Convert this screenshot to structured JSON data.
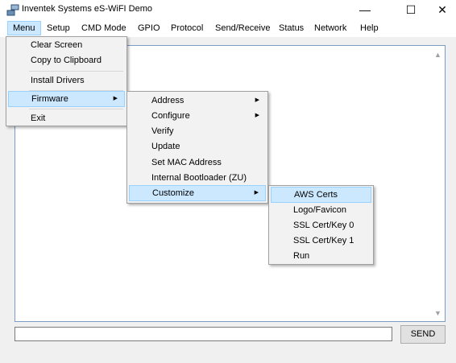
{
  "window": {
    "title": "Inventek Systems eS-WiFI Demo",
    "minimize_icon": "minimize-icon",
    "maximize_icon": "maximize-icon",
    "close_icon": "close-icon",
    "minimize_glyph": "—",
    "maximize_glyph": "☐",
    "close_glyph": "✕"
  },
  "menubar": {
    "items": [
      "Menu",
      "Setup",
      "CMD Mode",
      "GPIO",
      "Protocol",
      "Send/Receive",
      "Status",
      "Network",
      "Help"
    ],
    "active": "Menu"
  },
  "menu_dropdown": {
    "items": [
      "Clear Screen",
      "Copy to Clipboard",
      "Install Drivers",
      "Firmware",
      "Exit"
    ],
    "highlighted": "Firmware"
  },
  "firmware_submenu": {
    "items": [
      "Address",
      "Configure",
      "Verify",
      "Update",
      "Set MAC Address",
      "Internal Bootloader (ZU)",
      "Customize"
    ],
    "highlighted": "Customize"
  },
  "customize_submenu": {
    "items": [
      "AWS Certs",
      "Logo/Favicon",
      "SSL Cert/Key 0",
      "SSL Cert/Key 1",
      "Run"
    ],
    "highlighted": "AWS Certs"
  },
  "command": {
    "value": "",
    "send_label": "SEND"
  },
  "icons": {
    "submenu_arrow": "▶",
    "scroll_up": "▲",
    "scroll_down": "▼"
  },
  "colors": {
    "highlight_bg": "#cce8ff",
    "highlight_border": "#99d1ff",
    "menu_bg": "#f2f2f2"
  }
}
